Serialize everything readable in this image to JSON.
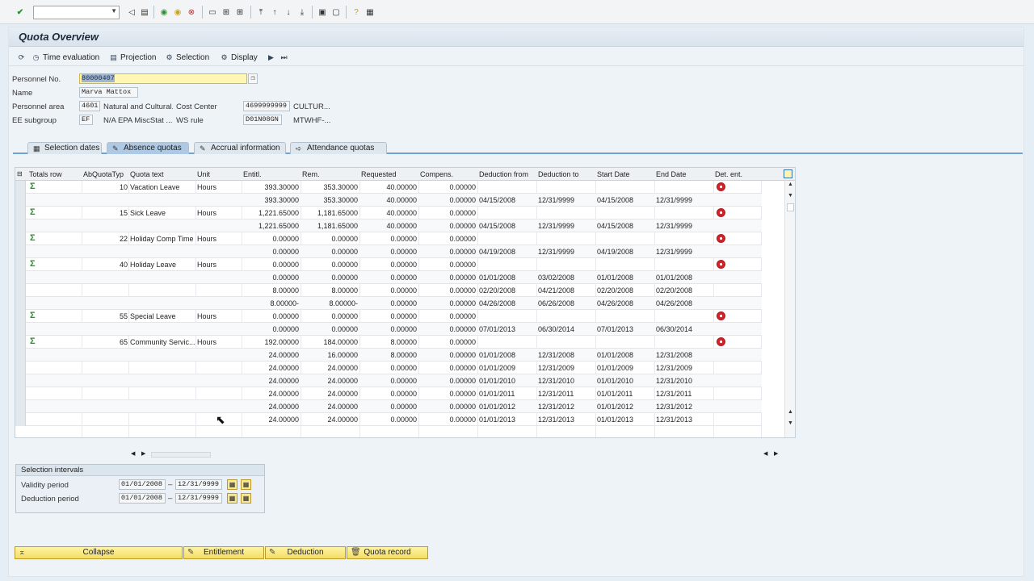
{
  "colors": {
    "accent": "#6fa3d0",
    "button": "#f4dd63",
    "input_bg": "#fff7b2",
    "sigma": "#2f8b2f",
    "detail": "#d2232a"
  },
  "title": "Quota Overview",
  "app_toolbar": {
    "time_evaluation": "Time evaluation",
    "projection": "Projection",
    "selection": "Selection",
    "display": "Display"
  },
  "header": {
    "personnel_no_label": "Personnel No.",
    "personnel_no_value": "80000407",
    "name_label": "Name",
    "name_value": "Marva Mattox",
    "personnel_area_label": "Personnel area",
    "personnel_area_code": "4601",
    "personnel_area_text": "Natural and Cultural...",
    "cost_center_label": "Cost Center",
    "cost_center_code": "4699999999",
    "cost_center_text": "CULTUR...",
    "ee_subgroup_label": "EE subgroup",
    "ee_subgroup_code": "EF",
    "ee_subgroup_text": "N/A EPA MiscStat ...",
    "ws_rule_label": "WS rule",
    "ws_rule_code": "D01N08GN",
    "ws_rule_text": "MTWHF-..."
  },
  "tabs": [
    "Selection dates",
    "Absence quotas",
    "Accrual information",
    "Attendance quotas"
  ],
  "active_tab": "Absence quotas",
  "grid": {
    "columns": [
      "Totals row",
      "AbQuotaTyp",
      "Quota text",
      "Unit",
      "Entitl.",
      "Rem.",
      "Requested",
      "Compens.",
      "Deduction from",
      "Deduction to",
      "Start Date",
      "End Date",
      "Det. ent."
    ],
    "rows": [
      {
        "sigma": true,
        "type": "10",
        "text": "Vacation Leave",
        "unit": "Hours",
        "entitl": "393.30000",
        "rem": "353.30000",
        "req": "40.00000",
        "comp": "0.00000",
        "dfrom": "",
        "dto": "",
        "start": "",
        "end": "",
        "det": true
      },
      {
        "sigma": false,
        "type": "",
        "text": "",
        "unit": "",
        "entitl": "393.30000",
        "rem": "353.30000",
        "req": "40.00000",
        "comp": "0.00000",
        "dfrom": "04/15/2008",
        "dto": "12/31/9999",
        "start": "04/15/2008",
        "end": "12/31/9999",
        "det": false
      },
      {
        "sigma": true,
        "type": "15",
        "text": "Sick Leave",
        "unit": "Hours",
        "entitl": "1,221.65000",
        "rem": "1,181.65000",
        "req": "40.00000",
        "comp": "0.00000",
        "dfrom": "",
        "dto": "",
        "start": "",
        "end": "",
        "det": true
      },
      {
        "sigma": false,
        "type": "",
        "text": "",
        "unit": "",
        "entitl": "1,221.65000",
        "rem": "1,181.65000",
        "req": "40.00000",
        "comp": "0.00000",
        "dfrom": "04/15/2008",
        "dto": "12/31/9999",
        "start": "04/15/2008",
        "end": "12/31/9999",
        "det": false
      },
      {
        "sigma": true,
        "type": "22",
        "text": "Holiday Comp Time",
        "unit": "Hours",
        "entitl": "0.00000",
        "rem": "0.00000",
        "req": "0.00000",
        "comp": "0.00000",
        "dfrom": "",
        "dto": "",
        "start": "",
        "end": "",
        "det": true
      },
      {
        "sigma": false,
        "type": "",
        "text": "",
        "unit": "",
        "entitl": "0.00000",
        "rem": "0.00000",
        "req": "0.00000",
        "comp": "0.00000",
        "dfrom": "04/19/2008",
        "dto": "12/31/9999",
        "start": "04/19/2008",
        "end": "12/31/9999",
        "det": false
      },
      {
        "sigma": true,
        "type": "40",
        "text": "Holiday Leave",
        "unit": "Hours",
        "entitl": "0.00000",
        "rem": "0.00000",
        "req": "0.00000",
        "comp": "0.00000",
        "dfrom": "",
        "dto": "",
        "start": "",
        "end": "",
        "det": true
      },
      {
        "sigma": false,
        "type": "",
        "text": "",
        "unit": "",
        "entitl": "0.00000",
        "rem": "0.00000",
        "req": "0.00000",
        "comp": "0.00000",
        "dfrom": "01/01/2008",
        "dto": "03/02/2008",
        "start": "01/01/2008",
        "end": "01/01/2008",
        "det": false
      },
      {
        "sigma": false,
        "type": "",
        "text": "",
        "unit": "",
        "entitl": "8.00000",
        "rem": "8.00000",
        "req": "0.00000",
        "comp": "0.00000",
        "dfrom": "02/20/2008",
        "dto": "04/21/2008",
        "start": "02/20/2008",
        "end": "02/20/2008",
        "det": false
      },
      {
        "sigma": false,
        "type": "",
        "text": "",
        "unit": "",
        "entitl": "8.00000-",
        "rem": "8.00000-",
        "req": "0.00000",
        "comp": "0.00000",
        "dfrom": "04/26/2008",
        "dto": "06/26/2008",
        "start": "04/26/2008",
        "end": "04/26/2008",
        "det": false
      },
      {
        "sigma": true,
        "type": "55",
        "text": "Special Leave",
        "unit": "Hours",
        "entitl": "0.00000",
        "rem": "0.00000",
        "req": "0.00000",
        "comp": "0.00000",
        "dfrom": "",
        "dto": "",
        "start": "",
        "end": "",
        "det": true
      },
      {
        "sigma": false,
        "type": "",
        "text": "",
        "unit": "",
        "entitl": "0.00000",
        "rem": "0.00000",
        "req": "0.00000",
        "comp": "0.00000",
        "dfrom": "07/01/2013",
        "dto": "06/30/2014",
        "start": "07/01/2013",
        "end": "06/30/2014",
        "det": false
      },
      {
        "sigma": true,
        "type": "65",
        "text": "Community Servic...",
        "unit": "Hours",
        "entitl": "192.00000",
        "rem": "184.00000",
        "req": "8.00000",
        "comp": "0.00000",
        "dfrom": "",
        "dto": "",
        "start": "",
        "end": "",
        "det": true
      },
      {
        "sigma": false,
        "type": "",
        "text": "",
        "unit": "",
        "entitl": "24.00000",
        "rem": "16.00000",
        "req": "8.00000",
        "comp": "0.00000",
        "dfrom": "01/01/2008",
        "dto": "12/31/2008",
        "start": "01/01/2008",
        "end": "12/31/2008",
        "det": false
      },
      {
        "sigma": false,
        "type": "",
        "text": "",
        "unit": "",
        "entitl": "24.00000",
        "rem": "24.00000",
        "req": "0.00000",
        "comp": "0.00000",
        "dfrom": "01/01/2009",
        "dto": "12/31/2009",
        "start": "01/01/2009",
        "end": "12/31/2009",
        "det": false
      },
      {
        "sigma": false,
        "type": "",
        "text": "",
        "unit": "",
        "entitl": "24.00000",
        "rem": "24.00000",
        "req": "0.00000",
        "comp": "0.00000",
        "dfrom": "01/01/2010",
        "dto": "12/31/2010",
        "start": "01/01/2010",
        "end": "12/31/2010",
        "det": false
      },
      {
        "sigma": false,
        "type": "",
        "text": "",
        "unit": "",
        "entitl": "24.00000",
        "rem": "24.00000",
        "req": "0.00000",
        "comp": "0.00000",
        "dfrom": "01/01/2011",
        "dto": "12/31/2011",
        "start": "01/01/2011",
        "end": "12/31/2011",
        "det": false
      },
      {
        "sigma": false,
        "type": "",
        "text": "",
        "unit": "",
        "entitl": "24.00000",
        "rem": "24.00000",
        "req": "0.00000",
        "comp": "0.00000",
        "dfrom": "01/01/2012",
        "dto": "12/31/2012",
        "start": "01/01/2012",
        "end": "12/31/2012",
        "det": false
      },
      {
        "sigma": false,
        "type": "",
        "text": "",
        "unit": "",
        "entitl": "24.00000",
        "rem": "24.00000",
        "req": "0.00000",
        "comp": "0.00000",
        "dfrom": "01/01/2013",
        "dto": "12/31/2013",
        "start": "01/01/2013",
        "end": "12/31/2013",
        "det": false
      }
    ]
  },
  "selection_intervals": {
    "title": "Selection intervals",
    "validity_label": "Validity period",
    "validity_from": "01/01/2008",
    "validity_to": "12/31/9999",
    "deduction_label": "Deduction period",
    "deduction_from": "01/01/2008",
    "deduction_to": "12/31/9999",
    "dash": "–"
  },
  "buttons": {
    "collapse": "Collapse",
    "entitlement": "Entitlement",
    "deduction": "Deduction",
    "quota_record": "Quota record"
  }
}
